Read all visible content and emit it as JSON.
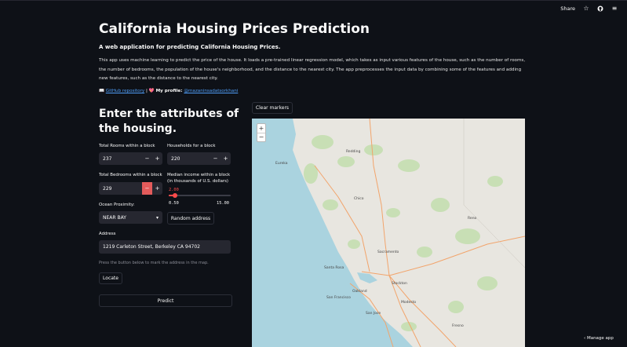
{
  "topbar": {
    "share_label": "Share",
    "icons": [
      "star-icon",
      "github-icon",
      "menu-icon"
    ]
  },
  "header": {
    "title": "California Housing Prices Prediction",
    "subtitle": "A web application for predicting California Housing Prices.",
    "description": "This app uses machine learning to predict the price of the house. It loads a pre-trained linear regression model, which takes as input various features of the house, such as the number of rooms, the number of bedrooms, the population of the house's neighborhood, and the distance to the nearest city. The app preprocesses the input data by combining some of the features and adding new features, such as the distance to the nearest city.",
    "links": {
      "repo_icon": "📖",
      "repo_label": "GitHub repository",
      "separator": " | ",
      "profile_icon": "💖",
      "profile_prefix": " My profile: ",
      "profile_label": "@mazaninsadatsorkhani"
    }
  },
  "form": {
    "heading": "Enter the attributes of the housing.",
    "total_rooms": {
      "label": "Total Rooms within a block",
      "value": "237"
    },
    "households": {
      "label": "Households for a block",
      "value": "220"
    },
    "total_bedrooms": {
      "label": "Total Bedrooms within a block",
      "value": "229"
    },
    "median_income": {
      "label": "Median income within a block (in thousands of U.S. dollars)",
      "value": "2.00",
      "min": "0.50",
      "max": "15.00",
      "fraction": 0.103
    },
    "ocean_proximity": {
      "label": "Ocean Proximity:",
      "value": "NEAR BAY"
    },
    "random_address_label": "Random address",
    "address": {
      "label": "Address",
      "value": "1219 Carleton Street, Berkeley CA 94702"
    },
    "hint": "Press the button below to mark the address in the map.",
    "locate_label": "Locate",
    "predict_label": "Predict"
  },
  "map": {
    "clear_markers_label": "Clear markers",
    "zoom_in": "+",
    "zoom_out": "−",
    "cities": [
      "Sacramento",
      "San Francisco",
      "San Jose",
      "Reno",
      "Fresno",
      "Redding",
      "Chico",
      "Eureka",
      "Stockton",
      "Modesto",
      "Santa Rosa",
      "Oakland"
    ],
    "colors": {
      "land": "#e8e6e0",
      "water": "#aad3df",
      "forest": "#c8dfb5",
      "road": "#f2a46b"
    }
  },
  "footer": {
    "manage_app_label": "Manage app"
  },
  "theme": {
    "background": "#0e1117",
    "widget": "#262730",
    "accent": "#ff4b4b",
    "link": "#4f9ef8"
  }
}
